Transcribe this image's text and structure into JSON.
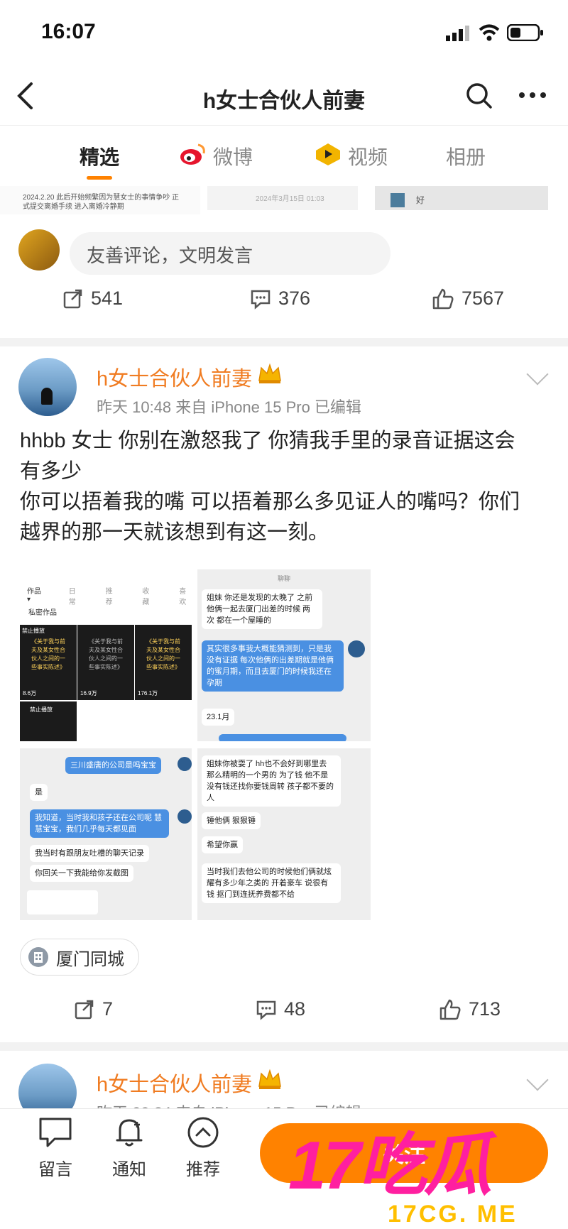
{
  "status_bar": {
    "time": "16:07"
  },
  "nav": {
    "title": "h女士合伙人前妻"
  },
  "tabs": [
    {
      "label": "精选",
      "active": true
    },
    {
      "label": "微博",
      "active": false
    },
    {
      "label": "视频",
      "active": false
    },
    {
      "label": "相册",
      "active": false
    }
  ],
  "top_strip": {
    "text_line1": "2024.2.20 此后开始频繁因为慧女士的事情争吵 正",
    "text_line2": "式提交离婚手续 进入离婚冷静期",
    "date": "2024年3月15日 01:03",
    "reply": "好"
  },
  "comment_box": {
    "placeholder": "友善评论，文明发言"
  },
  "prev_post_actions": {
    "repost": "541",
    "comment": "376",
    "like": "7567"
  },
  "post": {
    "author": "h女士合伙人前妻",
    "meta": "昨天 10:48  来自 iPhone 15 Pro  已编辑",
    "line1": "hhbb 女士 你别在激怒我了 你猜我手里的录音证据这会",
    "line2": "有多少",
    "line3": "你可以捂着我的嘴 可以捂着那么多见证人的嘴吗？你们",
    "line4": "越界的那一天就该想到有这一刻。",
    "images": {
      "img1": {
        "tabs": [
          "作品 ▾",
          "日常",
          "推荐",
          "收藏",
          "喜欢"
        ],
        "private": "私密作品",
        "tile_tag": "禁止播放",
        "tile_title": "《关于我与前夫及某女性合伙人之间的一些事实陈述》",
        "views": [
          "8.6万",
          "16.9万",
          "176.1万"
        ],
        "tile_tag2": "禁止播放"
      },
      "img2": {
        "header": "聊聊",
        "b1": "姐妹 你还是发现的太晚了 之前他俩一起去厦门出差的时候 两次 都在一个屋睡的",
        "b2": "其实很多事我大概能猜测到，只是我没有证据 每次他俩的出差期就是他俩的蜜月期，而且去厦门的时候我还在孕期",
        "b3": "23.1月"
      },
      "img3": {
        "b1": "三川盛唐的公司是吗宝宝",
        "b2": "是",
        "b3": "我知道，当时我和孩子还在公司呢 慧慧宝宝，我们几乎每天都见面",
        "b4": "我当时有跟朋友吐槽的聊天记录",
        "b5": "你回关一下我能给你发截图"
      },
      "img4": {
        "b1": "姐妹你被耍了 hh也不会好到哪里去 那么精明的一个男的 为了钱 他不是没有钱还找你要钱周转 孩子都不要的人",
        "b2": "锤他俩 狠狠锤",
        "b3": "希望你赢",
        "b4": "当时我们去他公司的时候他们俩就炫耀有多少年之类的 开着豪车 说很有钱 抠门到连抚养费都不给"
      }
    },
    "location": "厦门同城",
    "actions": {
      "repost": "7",
      "comment": "48",
      "like": "713"
    }
  },
  "next_post": {
    "author": "h女士合伙人前妻",
    "meta": "昨天 09:24  来自 iPhone 15 Pro  已编辑"
  },
  "bottom_nav": {
    "items": [
      {
        "label": "留言",
        "icon": "message-icon"
      },
      {
        "label": "通知",
        "icon": "bell-icon"
      },
      {
        "label": "推荐",
        "icon": "chevron-up-circle-icon"
      }
    ],
    "partial_button": "关注"
  },
  "watermark": {
    "big": "17吃瓜",
    "sub": "17CG. ME"
  },
  "colors": {
    "accent": "#ff8200",
    "author": "#f07c22",
    "blue_bubble": "#4a90e2"
  }
}
